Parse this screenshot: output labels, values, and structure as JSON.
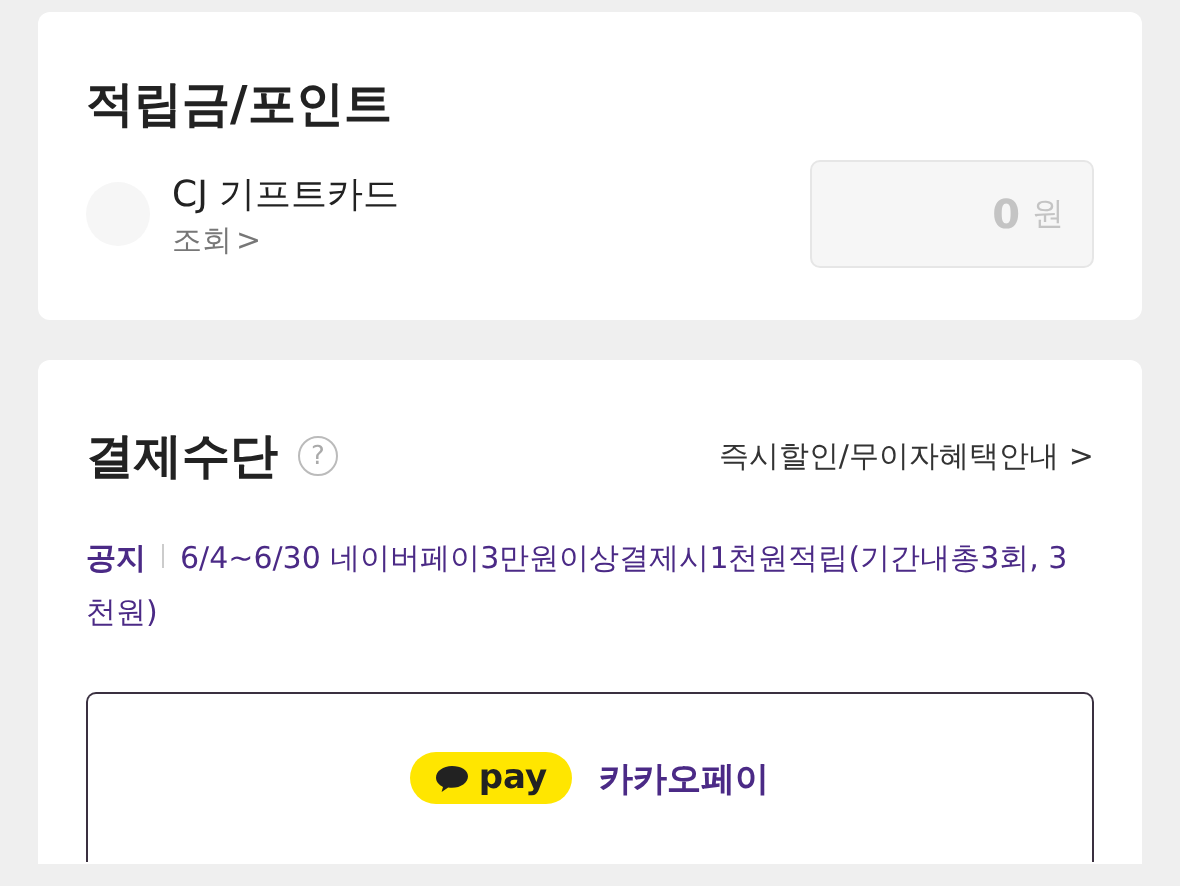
{
  "points": {
    "title": "적립금/포인트",
    "gift_card": {
      "name": "CJ 기프트카드",
      "link": "조회",
      "link_arrow": ">",
      "amount": "0",
      "unit": "원",
      "disabled": true
    }
  },
  "payment": {
    "title": "결제수단",
    "help_icon": "?",
    "benefit_link": "즉시할인/무이자혜택안내",
    "benefit_arrow": ">",
    "notice": {
      "label": "공지",
      "text": "6/4~6/30 네이버페이3만원이상결제시1천원적립(기간내총3회, 3천원)"
    },
    "methods": [
      {
        "badge": "pay",
        "name": "카카오페이",
        "selected": true
      }
    ]
  }
}
